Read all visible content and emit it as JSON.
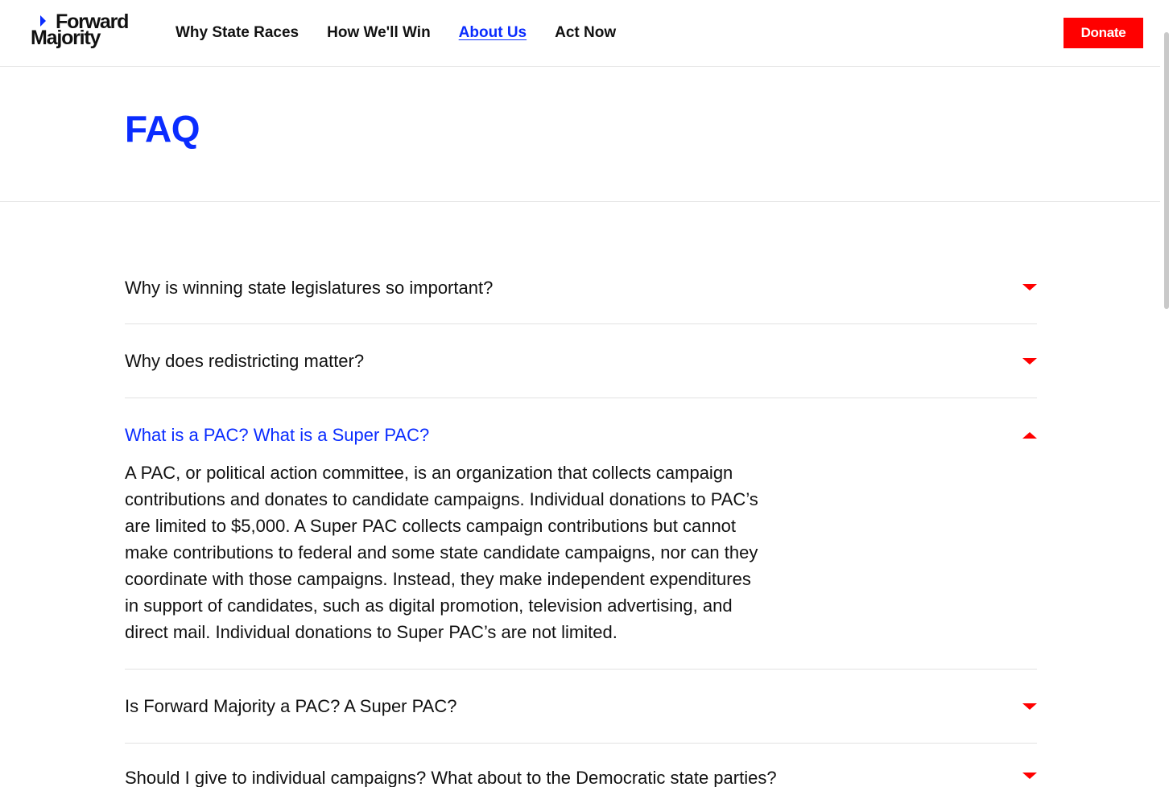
{
  "header": {
    "logo": {
      "line1": "Forward",
      "line2": "Majority"
    },
    "nav": [
      {
        "label": "Why State Races",
        "active": false
      },
      {
        "label": "How We'll Win",
        "active": false
      },
      {
        "label": "About Us",
        "active": true
      },
      {
        "label": "Act Now",
        "active": false
      }
    ],
    "donate_label": "Donate"
  },
  "page_title": "FAQ",
  "faq": [
    {
      "question": "Why is winning state legislatures so important?",
      "open": false
    },
    {
      "question": "Why does redistricting matter?",
      "open": false
    },
    {
      "question": "What is a PAC? What is a Super PAC?",
      "open": true,
      "answer": "A PAC, or political action committee, is an organization that collects campaign contributions and donates to candidate campaigns. Individual donations to PAC’s are limited to $5,000. A Super PAC collects campaign contributions but cannot make contributions to federal and some state candidate campaigns, nor can they coordinate with those campaigns. Instead, they make independent expenditures in support of candidates, such as digital promotion, television advertising, and direct mail. Individual donations to Super PAC’s are not limited."
    },
    {
      "question": "Is Forward Majority a PAC? A Super PAC?",
      "open": false
    },
    {
      "question": "Should I give to individual campaigns? What about to the Democratic state parties?",
      "open": false
    }
  ],
  "colors": {
    "accent_blue": "#0a2cff",
    "accent_red": "#ff0000",
    "text": "#111111"
  },
  "icons": {
    "collapsed": "caret-down-icon",
    "expanded": "caret-up-icon",
    "logo_mark": "play-arrow-icon"
  }
}
